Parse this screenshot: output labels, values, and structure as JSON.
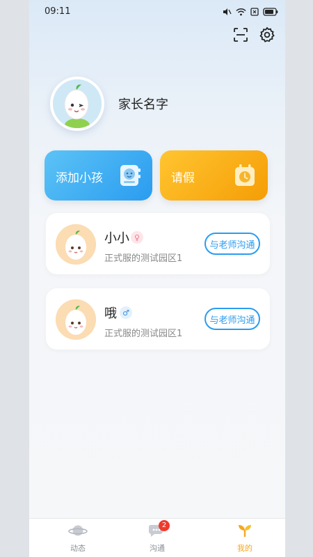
{
  "status_bar": {
    "time": "09:11"
  },
  "profile": {
    "parent_name": "家长名字"
  },
  "actions": {
    "add_child_label": "添加小孩",
    "leave_label": "请假",
    "add_color": "#2a9cf0",
    "leave_color": "#f59d06"
  },
  "children": [
    {
      "name": "小小",
      "gender_symbol": "♀",
      "gender": "female",
      "school": "正式服的测试园区1",
      "contact_label": "与老师沟通"
    },
    {
      "name": "哦",
      "gender_symbol": "♂",
      "gender": "male",
      "school": "正式服的测试园区1",
      "contact_label": "与老师沟通"
    }
  ],
  "tabbar": {
    "tabs": [
      {
        "label": "动态",
        "icon": "planet-icon"
      },
      {
        "label": "沟通",
        "icon": "chat-bubble-icon",
        "badge": "2"
      },
      {
        "label": "我的",
        "icon": "sprout-icon",
        "active": true
      }
    ],
    "active_color": "#f5a623"
  }
}
